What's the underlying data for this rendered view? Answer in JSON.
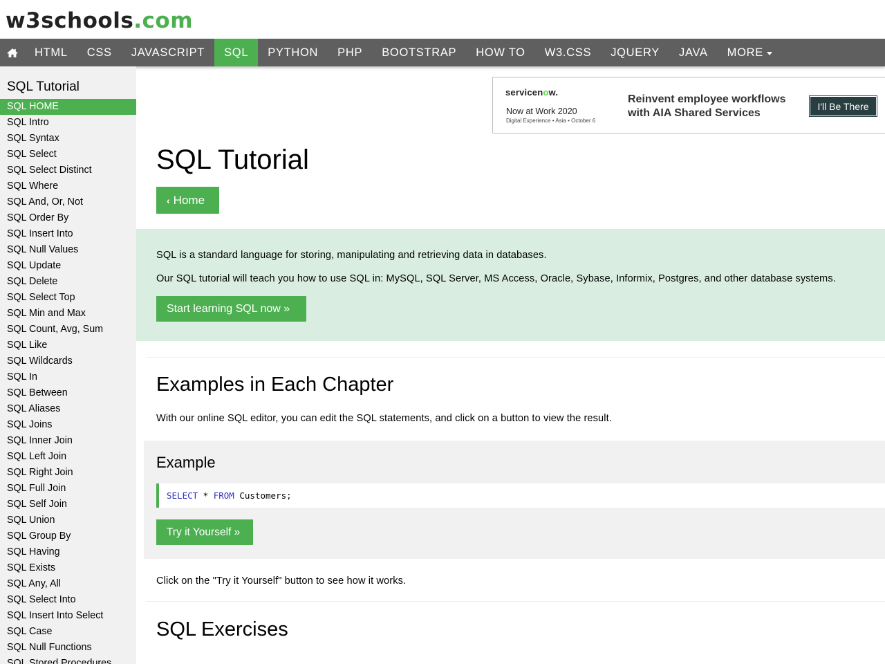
{
  "logo": {
    "part1": "w3schools",
    "part2": ".com"
  },
  "nav": {
    "home_icon": "home-icon",
    "items": [
      "HTML",
      "CSS",
      "JAVASCRIPT",
      "SQL",
      "PYTHON",
      "PHP",
      "BOOTSTRAP",
      "HOW TO",
      "W3.CSS",
      "JQUERY",
      "JAVA",
      "MORE"
    ],
    "active": "SQL"
  },
  "sidebar": {
    "title": "SQL Tutorial",
    "items": [
      "SQL HOME",
      "SQL Intro",
      "SQL Syntax",
      "SQL Select",
      "SQL Select Distinct",
      "SQL Where",
      "SQL And, Or, Not",
      "SQL Order By",
      "SQL Insert Into",
      "SQL Null Values",
      "SQL Update",
      "SQL Delete",
      "SQL Select Top",
      "SQL Min and Max",
      "SQL Count, Avg, Sum",
      "SQL Like",
      "SQL Wildcards",
      "SQL In",
      "SQL Between",
      "SQL Aliases",
      "SQL Joins",
      "SQL Inner Join",
      "SQL Left Join",
      "SQL Right Join",
      "SQL Full Join",
      "SQL Self Join",
      "SQL Union",
      "SQL Group By",
      "SQL Having",
      "SQL Exists",
      "SQL Any, All",
      "SQL Select Into",
      "SQL Insert Into Select",
      "SQL Case",
      "SQL Null Functions",
      "SQL Stored Procedures"
    ],
    "active": "SQL HOME"
  },
  "ad": {
    "brand_part1": "servicen",
    "brand_part2": "w",
    "brand_part3": ".",
    "event": "Now at Work 2020",
    "event_sub": "Digital Experience • Asia • October 6",
    "headline": "Reinvent employee workflows with AIA Shared Services",
    "cta": "I'll Be There"
  },
  "main": {
    "title": "SQL Tutorial",
    "home_button": "Home",
    "intro_p1": "SQL is a standard language for storing, manipulating and retrieving data in databases.",
    "intro_p2": "Our SQL tutorial will teach you how to use SQL in: MySQL, SQL Server, MS Access, Oracle, Sybase, Informix, Postgres, and other database systems.",
    "start_button": "Start learning SQL now »",
    "examples_title": "Examples in Each Chapter",
    "examples_text": "With our online SQL editor, you can edit the SQL statements, and click on a button to view the result.",
    "example_title": "Example",
    "code": {
      "kw1": "SELECT",
      "mid": " * ",
      "kw2": "FROM",
      "rest": " Customers;"
    },
    "try_button": "Try it Yourself »",
    "click_text": "Click on the \"Try it Yourself\" button to see how it works.",
    "exercises_title": "SQL Exercises"
  },
  "colors": {
    "accent": "#4CAF50",
    "nav_bg": "#5f5f5f",
    "sidebar_bg": "#f1f1f1",
    "intro_bg": "#d9eee1"
  }
}
